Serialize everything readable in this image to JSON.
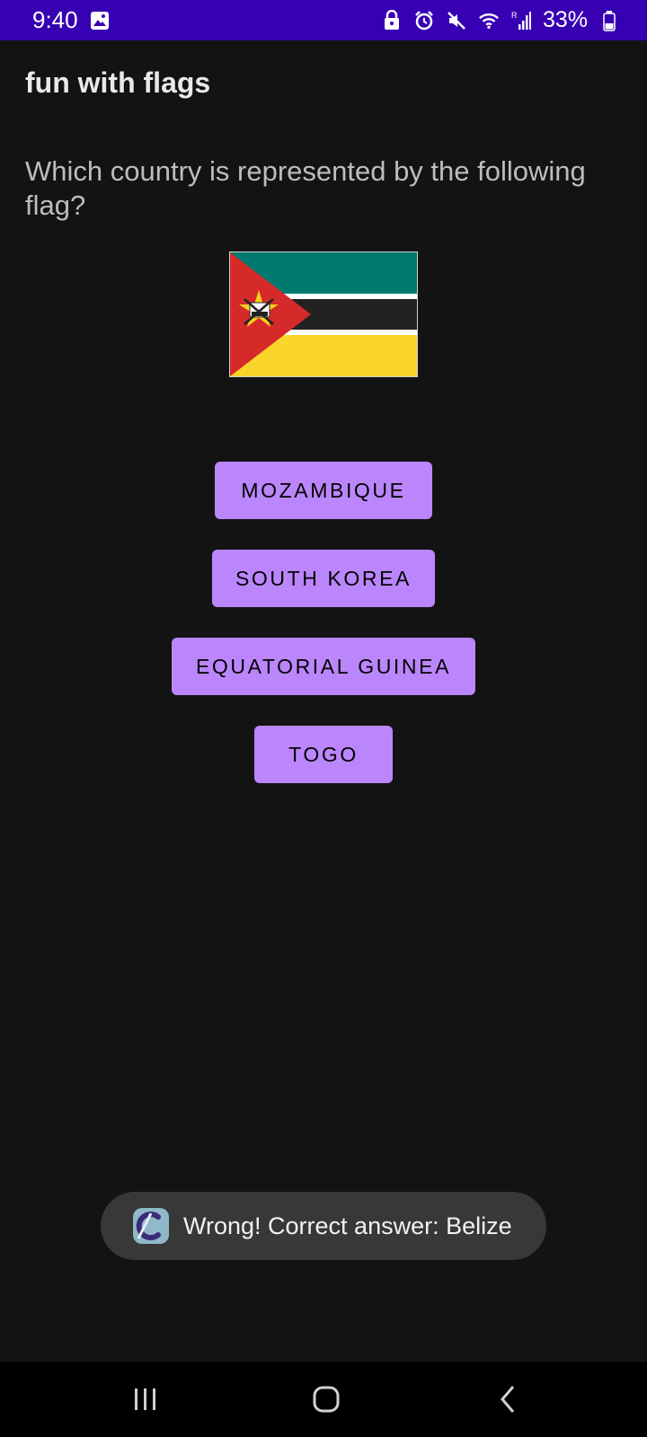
{
  "status_bar": {
    "time": "9:40",
    "battery": "33%",
    "icons": [
      "image-icon",
      "lock-icon",
      "alarm-icon",
      "mute-icon",
      "wifi-icon",
      "signal-icon",
      "battery-icon"
    ]
  },
  "app": {
    "title": "fun with flags"
  },
  "question": {
    "text": "Which country is represented by the following flag?"
  },
  "flag": {
    "icon": "mozambique-flag",
    "colors": {
      "green": "#007a6e",
      "black": "#222222",
      "yellow": "#fcd52a",
      "red": "#d62a2a",
      "white": "#ffffff",
      "star": "#f5d21b"
    }
  },
  "answers": [
    {
      "label": "MOZAMBIQUE"
    },
    {
      "label": "SOUTH KOREA"
    },
    {
      "label": "EQUATORIAL GUINEA"
    },
    {
      "label": "TOGO"
    }
  ],
  "toast": {
    "message": "Wrong! Correct answer: Belize",
    "icon": "app-logo-icon"
  },
  "nav": {
    "icons": [
      "recent-apps-icon",
      "home-icon",
      "back-icon"
    ]
  },
  "colors": {
    "status_bar": "#3700b3",
    "background": "#131313",
    "button": "#bb86fc",
    "toast": "#383838"
  }
}
